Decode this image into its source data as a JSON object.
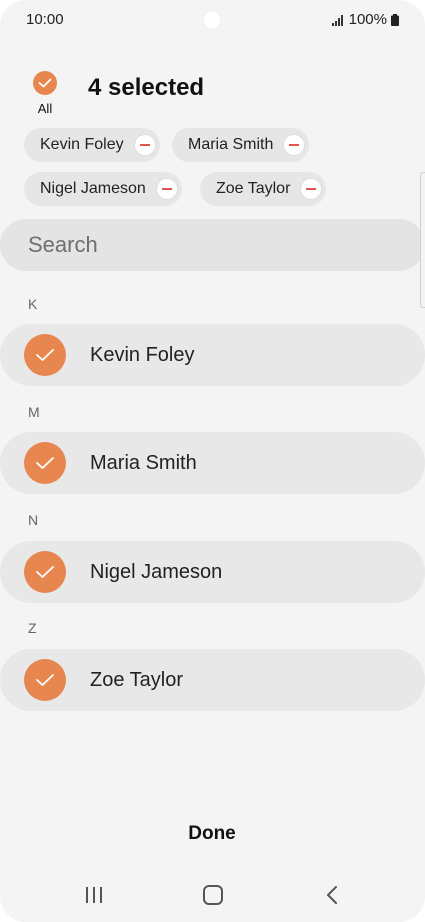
{
  "status_bar": {
    "time": "10:00",
    "battery": "100%"
  },
  "header": {
    "select_all_label": "All",
    "selected_count": "4 selected"
  },
  "chips": [
    {
      "label": "Kevin Foley"
    },
    {
      "label": "Maria Smith"
    },
    {
      "label": "Nigel Jameson"
    },
    {
      "label": "Zoe Taylor"
    }
  ],
  "search": {
    "placeholder": "Search"
  },
  "sections": [
    {
      "letter": "K",
      "contact": "Kevin Foley",
      "checked": true
    },
    {
      "letter": "M",
      "contact": "Maria Smith",
      "checked": true
    },
    {
      "letter": "N",
      "contact": "Nigel Jameson",
      "checked": true
    },
    {
      "letter": "Z",
      "contact": "Zoe Taylor",
      "checked": true
    }
  ],
  "footer": {
    "done_label": "Done"
  },
  "nav": {
    "recents_icon": "recents-icon",
    "home_icon": "home-icon",
    "back_icon": "back-icon"
  },
  "colors": {
    "accent": "#e8864f",
    "remove": "#e0554c",
    "background": "#f4f4f4",
    "row": "#e8e8e8"
  }
}
